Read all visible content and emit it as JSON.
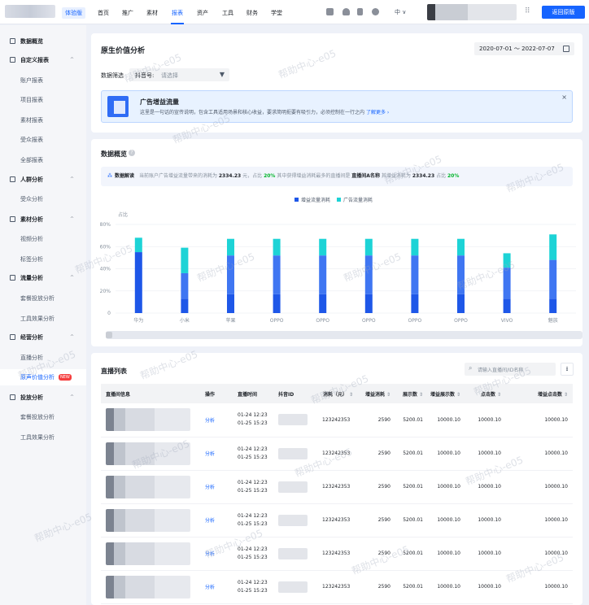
{
  "topnav": {
    "trial_label": "体验版",
    "items": [
      "首页",
      "推广",
      "素材",
      "报表",
      "资产",
      "工具",
      "财务",
      "学堂"
    ],
    "active_item": "报表",
    "lang": "中 ∨",
    "back_button": "返回原版"
  },
  "sidebar": {
    "items": [
      {
        "label": "数据概览",
        "type": "group",
        "icon": "grid-icon"
      },
      {
        "label": "自定义报表",
        "type": "group",
        "icon": "edit-icon",
        "chevron": "^"
      },
      {
        "label": "账户报表",
        "type": "sub"
      },
      {
        "label": "项目报表",
        "type": "sub"
      },
      {
        "label": "素材报表",
        "type": "sub"
      },
      {
        "label": "受众报表",
        "type": "sub"
      },
      {
        "label": "全部报表",
        "type": "sub"
      },
      {
        "label": "人群分析",
        "type": "group",
        "icon": "people-icon",
        "chevron": "^"
      },
      {
        "label": "受众分析",
        "type": "sub"
      },
      {
        "label": "素材分析",
        "type": "group",
        "icon": "material-icon",
        "chevron": "^"
      },
      {
        "label": "视频分析",
        "type": "sub"
      },
      {
        "label": "标签分析",
        "type": "sub"
      },
      {
        "label": "流量分析",
        "type": "group",
        "icon": "traffic-icon",
        "chevron": "^"
      },
      {
        "label": "套餐投放分析",
        "type": "sub"
      },
      {
        "label": "工具效果分析",
        "type": "sub"
      },
      {
        "label": "经营分析",
        "type": "group",
        "icon": "business-icon",
        "chevron": "^"
      },
      {
        "label": "直播分析",
        "type": "sub"
      },
      {
        "label": "原声价值分析",
        "type": "sub",
        "active": true,
        "badge": "NEW"
      },
      {
        "label": "投放分析",
        "type": "group",
        "icon": "delivery-icon",
        "chevron": "^"
      },
      {
        "label": "套餐投放分析",
        "type": "sub"
      },
      {
        "label": "工具效果分析",
        "type": "sub"
      }
    ]
  },
  "header": {
    "title": "原生价值分析",
    "date_range": "2020-07-01 ～ 2022-07-07",
    "filter_label": "数据筛选",
    "filter_field": "抖音号:",
    "filter_placeholder": "请选择"
  },
  "banner": {
    "title": "广告增益流量",
    "desc": "这里是一句话的宣传说明，包含工具适用场景和核心收益，要求简明扼要有吸引力，必须控制在一行之内",
    "link": "了解更多 ›",
    "close": "×"
  },
  "overview": {
    "title": "数据概览",
    "help": "?",
    "insight_head": "数据解读",
    "insight_icon": "⁂",
    "insight_p1": "当前账户广告增益流量带来的消耗为",
    "insight_v1": "2334.23",
    "insight_p2": "元，占比",
    "insight_pct1": "20%",
    "insight_p3": "其中获得增益消耗最多的直播间是",
    "insight_room": "直播间A名称",
    "insight_p4": "其增益消耗为",
    "insight_v2": "2334.23",
    "insight_p5": "占比",
    "insight_pct2": "20%"
  },
  "chart_data": {
    "type": "bar",
    "stacked": true,
    "ylabel": "占比",
    "yticks": [
      "80%",
      "60%",
      "40%",
      "20%",
      "0"
    ],
    "ylim": [
      0,
      80
    ],
    "categories": [
      "华为",
      "小米",
      "苹果",
      "OPPO",
      "OPPO",
      "OPPO",
      "OPPO",
      "OPPO",
      "VIVO",
      "魅族"
    ],
    "series": [
      {
        "name": "增益流量消耗",
        "color": "#1e57e8",
        "values": [
          55,
          13,
          17,
          17,
          17,
          17,
          17,
          17,
          13,
          13
        ]
      },
      {
        "name": "",
        "color": "#3f76f2",
        "values": [
          0,
          23,
          35,
          35,
          35,
          35,
          35,
          35,
          28,
          35
        ]
      },
      {
        "name": "广告流量消耗",
        "color": "#1dd3d6",
        "values": [
          13,
          23,
          15,
          15,
          15,
          15,
          15,
          15,
          13,
          23
        ]
      }
    ],
    "legend_position": "top-center"
  },
  "list": {
    "title": "直播列表",
    "search_placeholder": "请输入直播间/ID名称",
    "search_icon": "search-icon",
    "download_icon": "download-icon",
    "columns": [
      "直播间信息",
      "操作",
      "直播时间",
      "抖音ID",
      "消耗（元）",
      "增益消耗",
      "展示数",
      "增益展示数",
      "点击数",
      "增益点击数"
    ],
    "sortable": [
      false,
      false,
      false,
      false,
      true,
      true,
      true,
      true,
      true,
      true
    ],
    "rows": [
      {
        "op": "分析",
        "time1": "01-24 12:23",
        "time2": "01-25 15:23",
        "cost": "123242353",
        "gain_cost": "2590",
        "shows": "5200.01",
        "gain_shows": "10000.10",
        "clicks": "10000.10",
        "gain_clicks": "10000.10"
      },
      {
        "op": "分析",
        "time1": "01-24 12:23",
        "time2": "01-25 15:23",
        "cost": "123242353",
        "gain_cost": "2590",
        "shows": "5200.01",
        "gain_shows": "10000.10",
        "clicks": "10000.10",
        "gain_clicks": "10000.10"
      },
      {
        "op": "分析",
        "time1": "01-24 12:23",
        "time2": "01-25 15:23",
        "cost": "123242353",
        "gain_cost": "2590",
        "shows": "5200.01",
        "gain_shows": "10000.10",
        "clicks": "10000.10",
        "gain_clicks": "10000.10"
      },
      {
        "op": "分析",
        "time1": "01-24 12:23",
        "time2": "01-25 15:23",
        "cost": "123242353",
        "gain_cost": "2590",
        "shows": "5200.01",
        "gain_shows": "10000.10",
        "clicks": "10000.10",
        "gain_clicks": "10000.10"
      },
      {
        "op": "分析",
        "time1": "01-24 12:23",
        "time2": "01-25 15:23",
        "cost": "123242353",
        "gain_cost": "2590",
        "shows": "5200.01",
        "gain_shows": "10000.10",
        "clicks": "10000.10",
        "gain_clicks": "10000.10"
      },
      {
        "op": "分析",
        "time1": "01-24 12:23",
        "time2": "01-25 15:23",
        "cost": "123242353",
        "gain_cost": "2590",
        "shows": "5200.01",
        "gain_shows": "10000.10",
        "clicks": "10000.10",
        "gain_clicks": "10000.10"
      }
    ]
  },
  "watermark": "帮助中心-e05"
}
